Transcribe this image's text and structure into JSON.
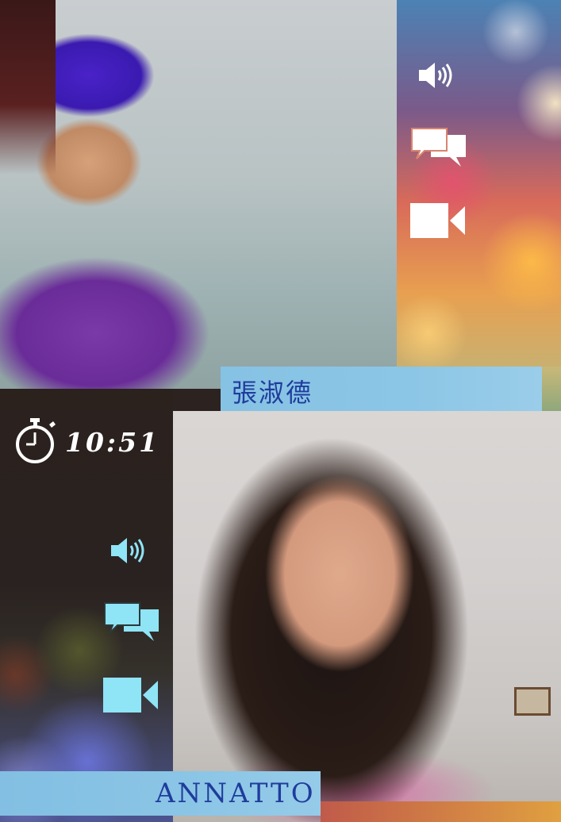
{
  "callers": [
    {
      "name": "張淑德",
      "controls": {
        "speaker_icon": "speaker-icon",
        "chat_icon": "chat-icon",
        "video_icon": "video-camera-icon"
      }
    },
    {
      "name": "ANNATTO",
      "controls": {
        "speaker_icon": "speaker-icon",
        "chat_icon": "chat-icon",
        "video_icon": "video-camera-icon"
      }
    }
  ],
  "timer": {
    "icon": "stopwatch-icon",
    "time": "10:51"
  },
  "colors": {
    "top_icon_color": "#ffffff",
    "bottom_icon_color": "#8fe4f6",
    "name_bar_color": "#8cc6e6",
    "name_text_color": "#1f3c9c"
  }
}
